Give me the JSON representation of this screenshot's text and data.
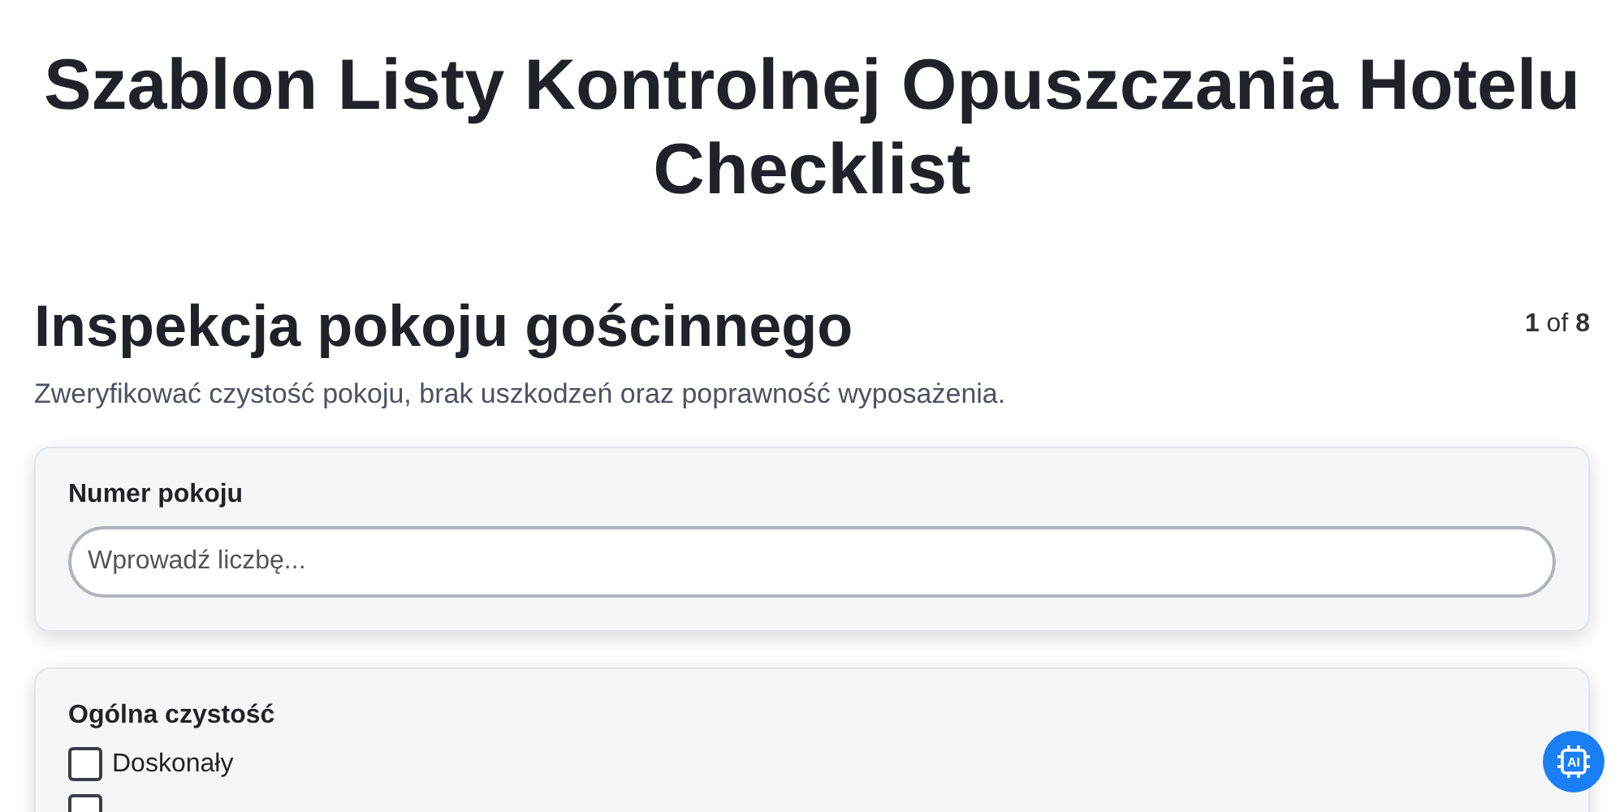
{
  "page_title": "Szablon Listy Kontrolnej Opuszczania Hotelu Checklist",
  "section": {
    "title": "Inspekcja pokoju gościnnego",
    "progress": {
      "current": "1",
      "separator": "of",
      "total": "8"
    },
    "description": "Zweryfikować czystość pokoju, brak uszkodzeń oraz poprawność wyposażenia."
  },
  "fields": [
    {
      "kind": "number",
      "label": "Numer pokoju",
      "placeholder": "Wprowadź liczbę..."
    },
    {
      "kind": "checkboxes",
      "label": "Ogólna czystość",
      "options": [
        {
          "label": "Doskonały",
          "checked": false
        },
        {
          "checked": false
        }
      ]
    }
  ],
  "assistant_button": {
    "label": "AI"
  }
}
